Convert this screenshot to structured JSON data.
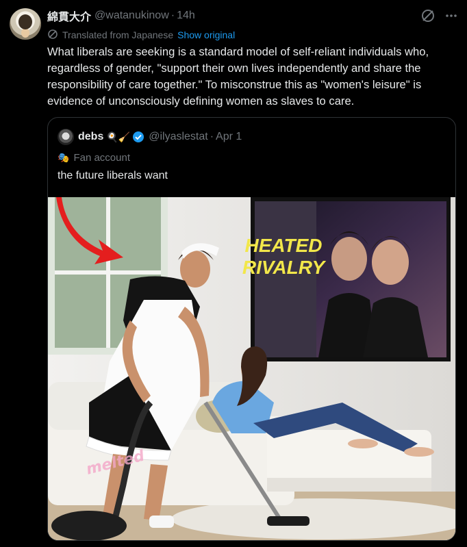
{
  "tweet": {
    "name": "綿貫大介",
    "handle": "@watanukinow",
    "separator": "·",
    "time": "14h",
    "translated_label": "Translated from Japanese",
    "show_original": "Show original",
    "text": "What liberals are seeking is a standard model of self-reliant individuals who, regardless of gender, \"support their own lives independently and share the responsibility of care together.\" To misconstrue this as \"women's leisure\" is evidence of unconsciously defining women as slaves to care."
  },
  "quote": {
    "name": "debs",
    "emoji": "🍳🧹",
    "handle": "@ilyaslestat",
    "separator": "·",
    "date": "Apr 1",
    "label": "Fan account",
    "text": "the future liberals want",
    "image": {
      "tv_title_line1": "HEATED",
      "tv_title_line2": "RIVALRY",
      "watermark": "melted"
    }
  },
  "colors": {
    "background": "#000000",
    "text": "#e7e9ea",
    "muted": "#71767b",
    "link": "#1d9bf0",
    "border": "#2f3336",
    "tv_title": "#f2e74a"
  },
  "icons": [
    "translate-icon",
    "more-icon",
    "verified-icon",
    "mask-icon",
    "arrow-icon"
  ]
}
